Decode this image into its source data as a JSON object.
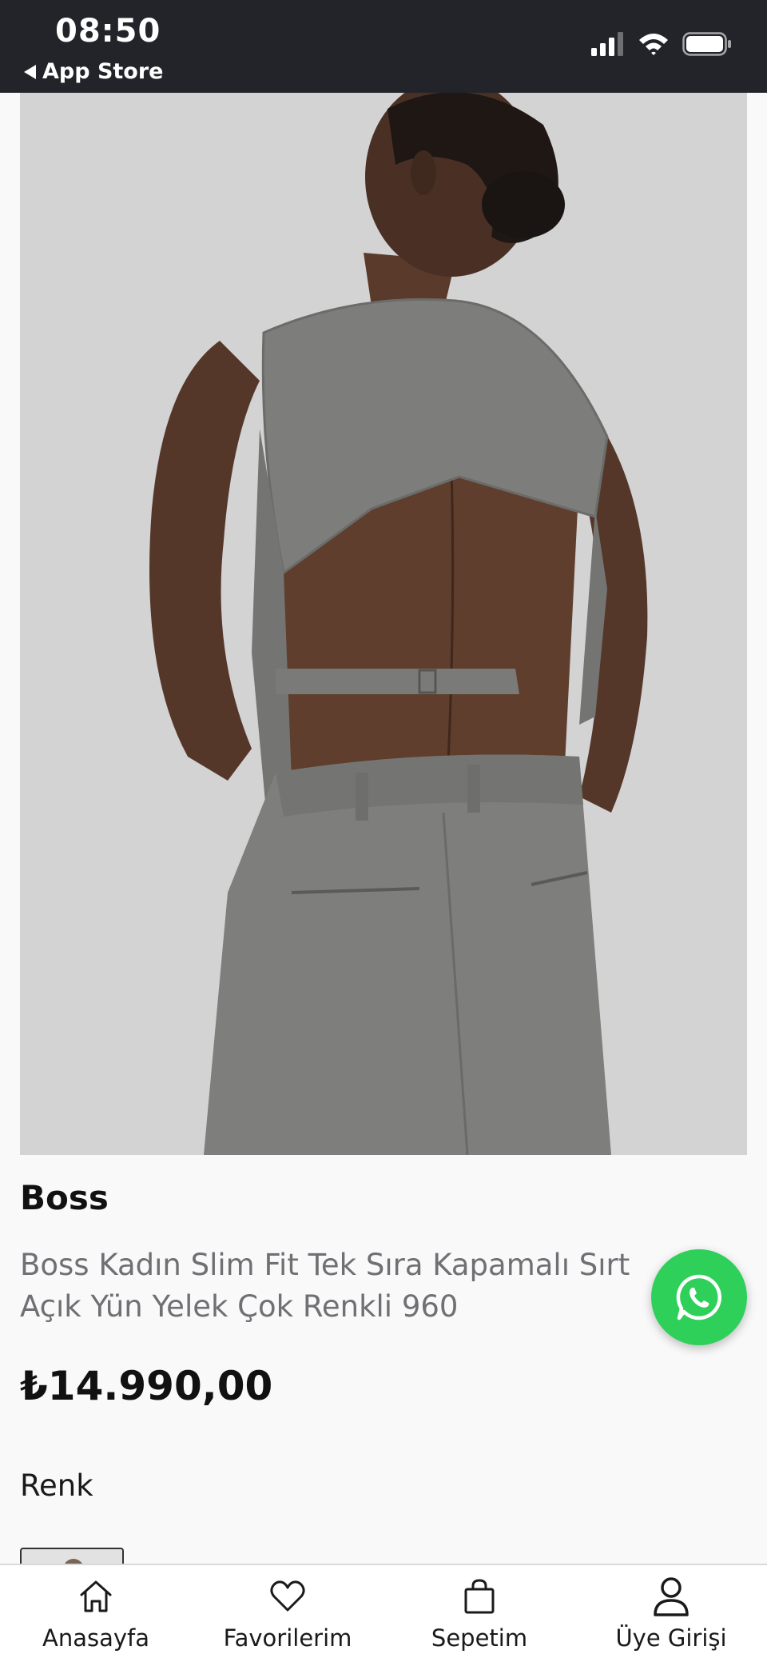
{
  "status_bar": {
    "time": "08:50",
    "back_label": "App Store"
  },
  "product": {
    "brand": "Boss",
    "title": "Boss Kadın Slim Fit Tek Sıra Kapamalı Sırt Açık Yün Yelek Çok Renkli 960",
    "price": "₺14.990,00",
    "color_label": "Renk"
  },
  "tab_bar": {
    "items": [
      {
        "label": "Anasayfa",
        "icon": "home-icon"
      },
      {
        "label": "Favorilerim",
        "icon": "heart-icon"
      },
      {
        "label": "Sepetim",
        "icon": "bag-icon"
      },
      {
        "label": "Üye Girişi",
        "icon": "user-icon"
      }
    ]
  },
  "colors": {
    "status_bar_bg": "#22242a",
    "whatsapp_green": "#2fd05a",
    "image_bg": "#d3d3d4"
  }
}
